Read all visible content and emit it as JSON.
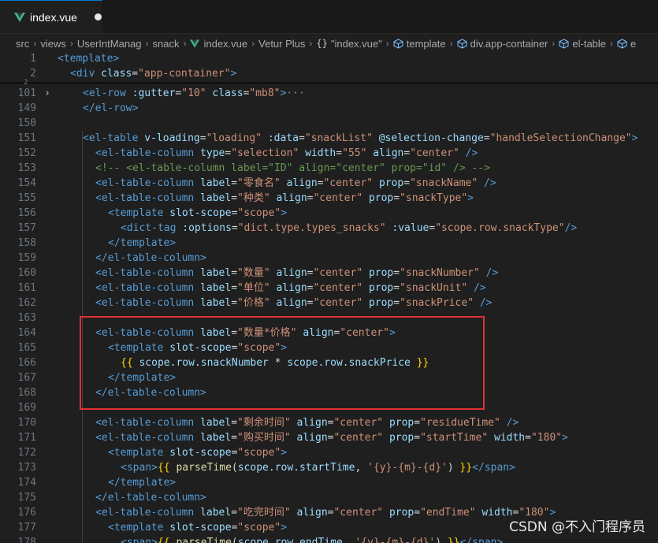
{
  "tab": {
    "filename": "index.vue",
    "dirty": true
  },
  "breadcrumb": [
    "src",
    "views",
    "UserIntManag",
    "snack",
    "index.vue",
    "Vetur Plus",
    "\"index.vue\"",
    "template",
    "div.app-container",
    "el-table",
    "e"
  ],
  "sticky": [
    {
      "num": "1",
      "html": "<span class=\"tag\">&lt;template&gt;</span>",
      "indent": 0
    },
    {
      "num": "2",
      "html": "<span class=\"tag\">&lt;div</span> <span class=\"attr\">class</span><span class=\"plain\">=</span><span class=\"str\">\"app-container\"</span><span class=\"tag\">&gt;</span>",
      "indent": 1
    }
  ],
  "lines": [
    {
      "num": "101",
      "html": "<span class=\"tag\">&lt;el-row</span> <span class=\"attr\">:gutter</span><span class=\"plain\">=</span><span class=\"str\">\"10\"</span> <span class=\"attr\">class</span><span class=\"plain\">=</span><span class=\"str\">\"mb8\"</span><span class=\"tag\">&gt;</span><span class=\"ellipsis\">···</span>",
      "indent": 2,
      "fold": true
    },
    {
      "num": "149",
      "html": "<span class=\"tag\">&lt;/el-row&gt;</span>",
      "indent": 2
    },
    {
      "num": "150",
      "html": "",
      "indent": 0
    },
    {
      "num": "151",
      "html": "<span class=\"tag\">&lt;el-table</span> <span class=\"attr\">v-loading</span><span class=\"plain\">=</span><span class=\"str\">\"loading\"</span> <span class=\"attr\">:data</span><span class=\"plain\">=</span><span class=\"str\">\"snackList\"</span> <span class=\"attr\">@selection-change</span><span class=\"plain\">=</span><span class=\"str\">\"handleSelectionChange\"</span><span class=\"tag\">&gt;</span>",
      "indent": 2
    },
    {
      "num": "152",
      "html": "<span class=\"tag\">&lt;el-table-column</span> <span class=\"attr\">type</span><span class=\"plain\">=</span><span class=\"str\">\"selection\"</span> <span class=\"attr\">width</span><span class=\"plain\">=</span><span class=\"str\">\"55\"</span> <span class=\"attr\">align</span><span class=\"plain\">=</span><span class=\"str\">\"center\"</span> <span class=\"tag\">/&gt;</span>",
      "indent": 3
    },
    {
      "num": "153",
      "html": "<span class=\"comment\">&lt;!-- &lt;el-table-column label=\"ID\" align=\"center\" prop=\"id\" /&gt; --&gt;</span>",
      "indent": 3
    },
    {
      "num": "154",
      "html": "<span class=\"tag\">&lt;el-table-column</span> <span class=\"attr\">label</span><span class=\"plain\">=</span><span class=\"str\">\"零食名\"</span> <span class=\"attr\">align</span><span class=\"plain\">=</span><span class=\"str\">\"center\"</span> <span class=\"attr\">prop</span><span class=\"plain\">=</span><span class=\"str\">\"snackName\"</span> <span class=\"tag\">/&gt;</span>",
      "indent": 3
    },
    {
      "num": "155",
      "html": "<span class=\"tag\">&lt;el-table-column</span> <span class=\"attr\">label</span><span class=\"plain\">=</span><span class=\"str\">\"种类\"</span> <span class=\"attr\">align</span><span class=\"plain\">=</span><span class=\"str\">\"center\"</span> <span class=\"attr\">prop</span><span class=\"plain\">=</span><span class=\"str\">\"snackType\"</span><span class=\"tag\">&gt;</span>",
      "indent": 3
    },
    {
      "num": "156",
      "html": "<span class=\"tag\">&lt;template</span> <span class=\"attr\">slot-scope</span><span class=\"plain\">=</span><span class=\"str\">\"scope\"</span><span class=\"tag\">&gt;</span>",
      "indent": 4
    },
    {
      "num": "157",
      "html": "<span class=\"tag\">&lt;dict-tag</span> <span class=\"attr\">:options</span><span class=\"plain\">=</span><span class=\"str\">\"dict.type.types_snacks\"</span> <span class=\"attr\">:value</span><span class=\"plain\">=</span><span class=\"str\">\"scope.row.snackType\"</span><span class=\"tag\">/&gt;</span>",
      "indent": 5
    },
    {
      "num": "158",
      "html": "<span class=\"tag\">&lt;/template&gt;</span>",
      "indent": 4
    },
    {
      "num": "159",
      "html": "<span class=\"tag\">&lt;/el-table-column&gt;</span>",
      "indent": 3
    },
    {
      "num": "160",
      "html": "<span class=\"tag\">&lt;el-table-column</span> <span class=\"attr\">label</span><span class=\"plain\">=</span><span class=\"str\">\"数量\"</span> <span class=\"attr\">align</span><span class=\"plain\">=</span><span class=\"str\">\"center\"</span> <span class=\"attr\">prop</span><span class=\"plain\">=</span><span class=\"str\">\"snackNumber\"</span> <span class=\"tag\">/&gt;</span>",
      "indent": 3
    },
    {
      "num": "161",
      "html": "<span class=\"tag\">&lt;el-table-column</span> <span class=\"attr\">label</span><span class=\"plain\">=</span><span class=\"str\">\"单位\"</span> <span class=\"attr\">align</span><span class=\"plain\">=</span><span class=\"str\">\"center\"</span> <span class=\"attr\">prop</span><span class=\"plain\">=</span><span class=\"str\">\"snackUnit\"</span> <span class=\"tag\">/&gt;</span>",
      "indent": 3
    },
    {
      "num": "162",
      "html": "<span class=\"tag\">&lt;el-table-column</span> <span class=\"attr\">label</span><span class=\"plain\">=</span><span class=\"str\">\"价格\"</span> <span class=\"attr\">align</span><span class=\"plain\">=</span><span class=\"str\">\"center\"</span> <span class=\"attr\">prop</span><span class=\"plain\">=</span><span class=\"str\">\"snackPrice\"</span> <span class=\"tag\">/&gt;</span>",
      "indent": 3
    },
    {
      "num": "163",
      "html": "",
      "indent": 0
    },
    {
      "num": "164",
      "html": "<span class=\"tag\">&lt;el-table-column</span> <span class=\"attr\">label</span><span class=\"plain\">=</span><span class=\"str\">\"数量*价格\"</span> <span class=\"attr\">align</span><span class=\"plain\">=</span><span class=\"str\">\"center\"</span><span class=\"tag\">&gt;</span>",
      "indent": 3
    },
    {
      "num": "165",
      "html": "<span class=\"tag\">&lt;template</span> <span class=\"attr\">slot-scope</span><span class=\"plain\">=</span><span class=\"str\">\"scope\"</span><span class=\"tag\">&gt;</span>",
      "indent": 4
    },
    {
      "num": "166",
      "html": "<span class=\"brace\">{{</span> <span class=\"attr\">scope.row.snackNumber</span> <span class=\"plain\">*</span> <span class=\"attr\">scope.row.snackPrice</span> <span class=\"brace\">}}</span>",
      "indent": 5
    },
    {
      "num": "167",
      "html": "<span class=\"tag\">&lt;/template&gt;</span>",
      "indent": 4
    },
    {
      "num": "168",
      "html": "<span class=\"tag\">&lt;/el-table-column&gt;</span>",
      "indent": 3
    },
    {
      "num": "169",
      "html": "",
      "indent": 0
    },
    {
      "num": "170",
      "html": "<span class=\"tag\">&lt;el-table-column</span> <span class=\"attr\">label</span><span class=\"plain\">=</span><span class=\"str\">\"剩余时间\"</span> <span class=\"attr\">align</span><span class=\"plain\">=</span><span class=\"str\">\"center\"</span> <span class=\"attr\">prop</span><span class=\"plain\">=</span><span class=\"str\">\"residueTime\"</span> <span class=\"tag\">/&gt;</span>",
      "indent": 3
    },
    {
      "num": "171",
      "html": "<span class=\"tag\">&lt;el-table-column</span> <span class=\"attr\">label</span><span class=\"plain\">=</span><span class=\"str\">\"购买时间\"</span> <span class=\"attr\">align</span><span class=\"plain\">=</span><span class=\"str\">\"center\"</span> <span class=\"attr\">prop</span><span class=\"plain\">=</span><span class=\"str\">\"startTime\"</span> <span class=\"attr\">width</span><span class=\"plain\">=</span><span class=\"str\">\"180\"</span><span class=\"tag\">&gt;</span>",
      "indent": 3
    },
    {
      "num": "172",
      "html": "<span class=\"tag\">&lt;template</span> <span class=\"attr\">slot-scope</span><span class=\"plain\">=</span><span class=\"str\">\"scope\"</span><span class=\"tag\">&gt;</span>",
      "indent": 4
    },
    {
      "num": "173",
      "html": "<span class=\"tag\">&lt;span&gt;</span><span class=\"brace\">{{</span> <span class=\"fn\">parseTime</span><span class=\"plain\">(</span><span class=\"attr\">scope.row.startTime</span><span class=\"plain\">, </span><span class=\"str\">'{y}-{m}-{d}'</span><span class=\"plain\">)</span> <span class=\"brace\">}}</span><span class=\"tag\">&lt;/span&gt;</span>",
      "indent": 5
    },
    {
      "num": "174",
      "html": "<span class=\"tag\">&lt;/template&gt;</span>",
      "indent": 4
    },
    {
      "num": "175",
      "html": "<span class=\"tag\">&lt;/el-table-column&gt;</span>",
      "indent": 3
    },
    {
      "num": "176",
      "html": "<span class=\"tag\">&lt;el-table-column</span> <span class=\"attr\">label</span><span class=\"plain\">=</span><span class=\"str\">\"吃完时间\"</span> <span class=\"attr\">align</span><span class=\"plain\">=</span><span class=\"str\">\"center\"</span> <span class=\"attr\">prop</span><span class=\"plain\">=</span><span class=\"str\">\"endTime\"</span> <span class=\"attr\">width</span><span class=\"plain\">=</span><span class=\"str\">\"180\"</span><span class=\"tag\">&gt;</span>",
      "indent": 3
    },
    {
      "num": "177",
      "html": "<span class=\"tag\">&lt;template</span> <span class=\"attr\">slot-scope</span><span class=\"plain\">=</span><span class=\"str\">\"scope\"</span><span class=\"tag\">&gt;</span>",
      "indent": 4
    },
    {
      "num": "178",
      "html": "<span class=\"tag\">&lt;span&gt;</span><span class=\"brace\">{{</span> <span class=\"fn\">parseTime</span><span class=\"plain\">(</span><span class=\"attr\">scope.row.endTime</span><span class=\"plain\">, </span><span class=\"str\">'{y}-{m}-{d}'</span><span class=\"plain\">)</span> <span class=\"brace\">}}</span><span class=\"tag\">&lt;/span&gt;</span>",
      "indent": 5
    }
  ],
  "mini_number": "2",
  "watermark": "CSDN @不入门程序员",
  "colors": {
    "highlight_border": "#e03131",
    "tab_accent": "#0078d4"
  }
}
